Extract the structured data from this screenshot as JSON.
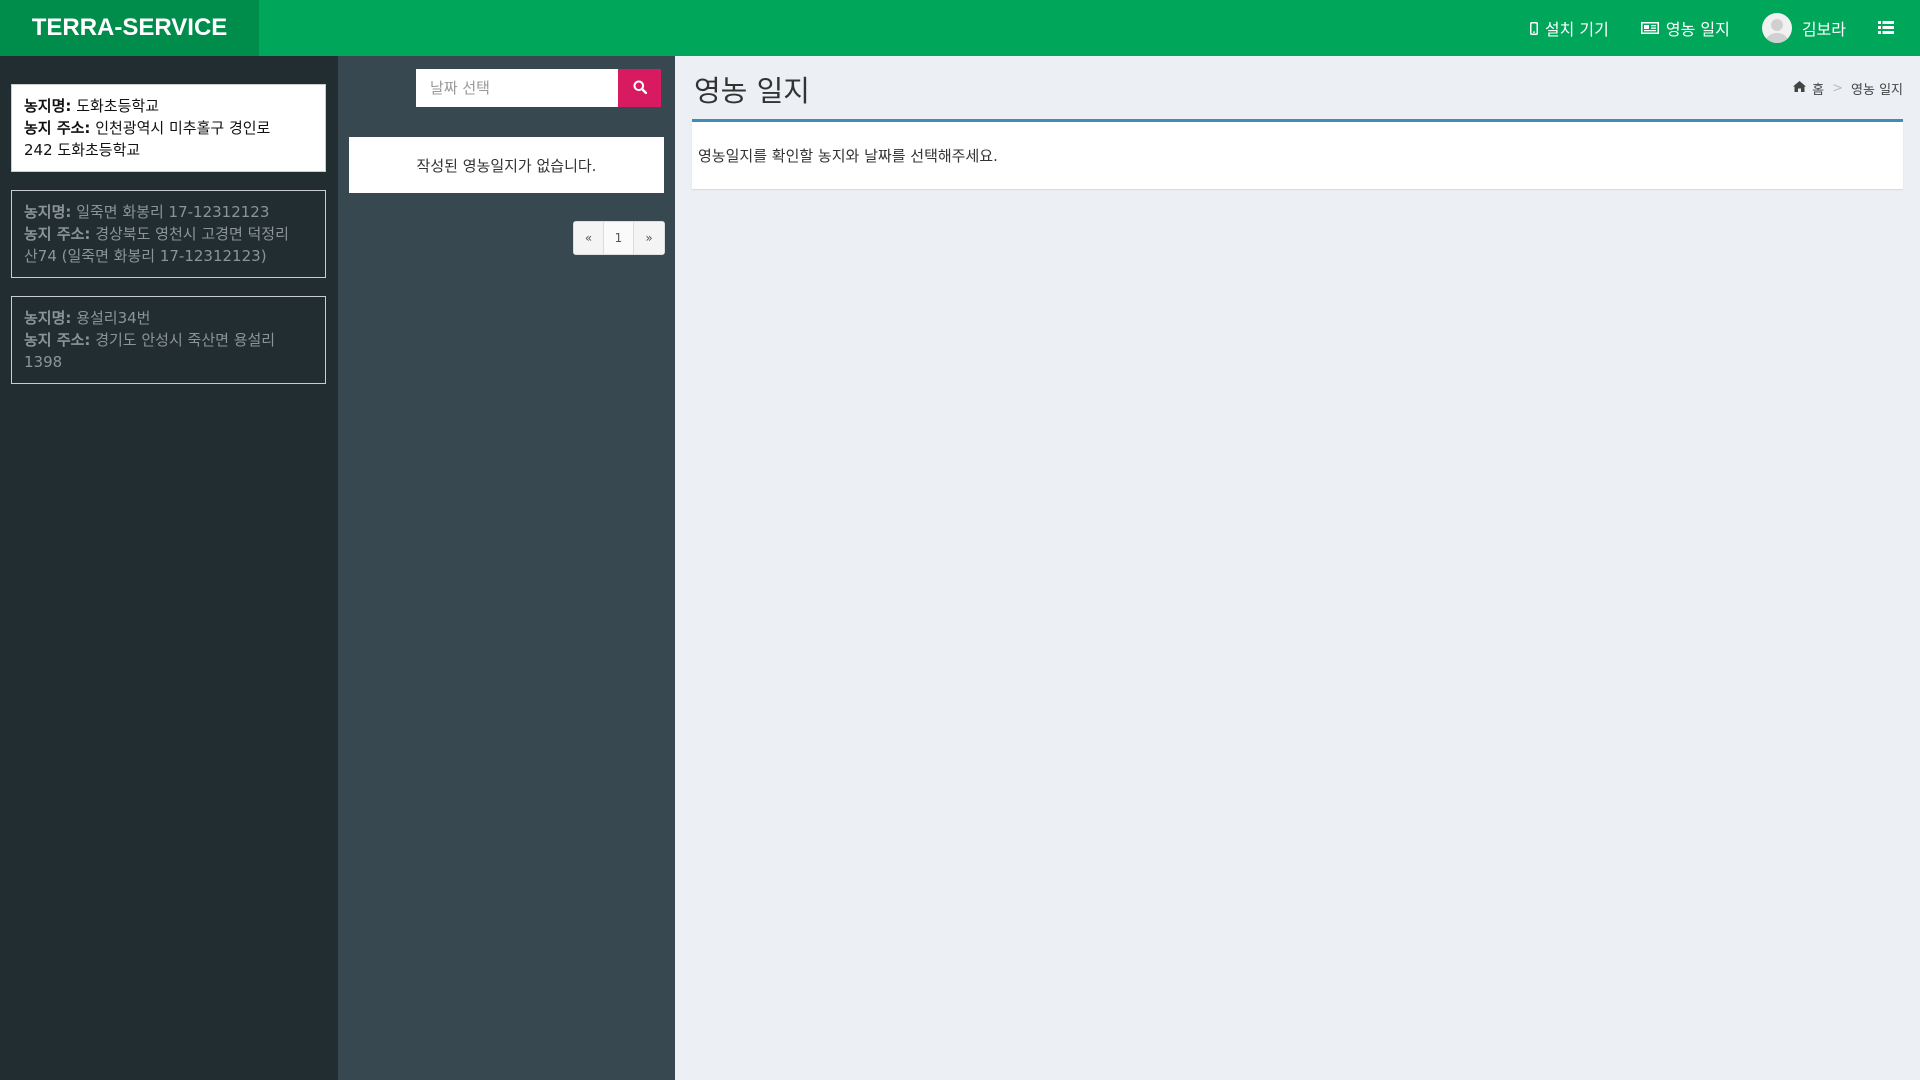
{
  "header": {
    "logo": "TERRA-SERVICE",
    "nav": {
      "devices_label": "설치 기기",
      "journal_label": "영농 일지",
      "user_name": "김보라"
    }
  },
  "sidebar": {
    "farms": [
      {
        "name_label": "농지명:",
        "name": "도화초등학교",
        "addr_label": "농지 주소:",
        "addr_line1": "인천광역시 미추홀구 경인로",
        "addr_line2": "242 도화초등학교",
        "active": true
      },
      {
        "name_label": "농지명:",
        "name": "일죽면 화봉리 17-12312123",
        "addr_label": "농지 주소:",
        "addr_line1": "경상북도 영천시 고경면 덕정리",
        "addr_line2": "산74 (일죽면 화봉리 17-12312123)",
        "active": false
      },
      {
        "name_label": "농지명:",
        "name": "용설리34번",
        "addr_label": "농지 주소:",
        "addr_line1": "경기도 안성시 죽산면 용설리",
        "addr_line2": "1398",
        "active": false
      }
    ]
  },
  "middle": {
    "date_placeholder": "날짜 선택",
    "empty_message": "작성된 영농일지가 없습니다.",
    "pagination": {
      "prev": "«",
      "page": "1",
      "next": "»"
    }
  },
  "content": {
    "title": "영농 일지",
    "breadcrumb": {
      "home": "홈",
      "current": "영농 일지"
    },
    "message": "영농일지를 확인할 농지와 날짜를 선택해주세요."
  },
  "colors": {
    "header": "#00a65a",
    "logo_bg": "#008d4c",
    "sidebar": "#222d32",
    "middle": "#374850",
    "search_button": "#d81b60",
    "box_border": "#3c8dbc"
  }
}
